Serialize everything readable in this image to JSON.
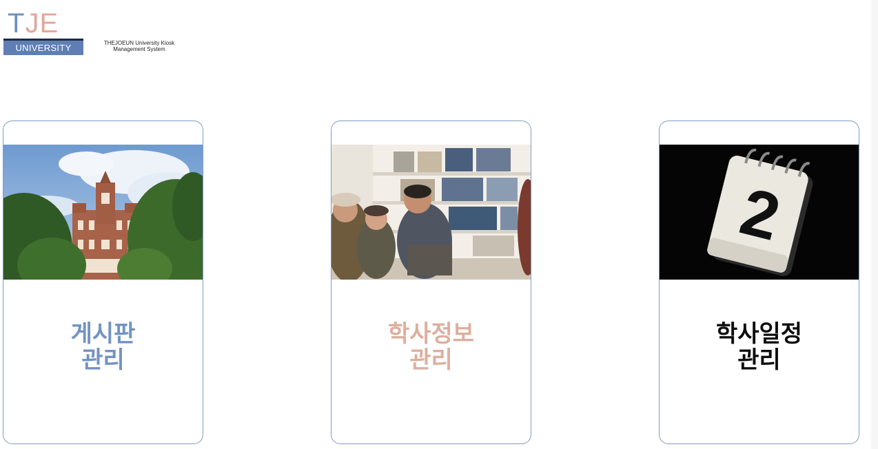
{
  "logo": {
    "letters": [
      "T",
      "J",
      "E"
    ],
    "bar_text": "UNIVERSITY",
    "subtitle_line1": "THEJOEUN University Kiosk",
    "subtitle_line2": "Management System",
    "colors": {
      "blue": "#6f8fbf",
      "peach": "#e2a79a",
      "bar": "#5f7fb4"
    }
  },
  "cards": [
    {
      "line1": "게시판",
      "line2": "관리",
      "color": "#7392c3",
      "image": "university-building"
    },
    {
      "line1": "학사정보",
      "line2": "관리",
      "color": "#dcaf9f",
      "image": "students-library"
    },
    {
      "line1": "학사일정",
      "line2": "관리",
      "color": "#0d0d0d",
      "image": "calendar-2"
    }
  ],
  "calendar_digit": "2"
}
